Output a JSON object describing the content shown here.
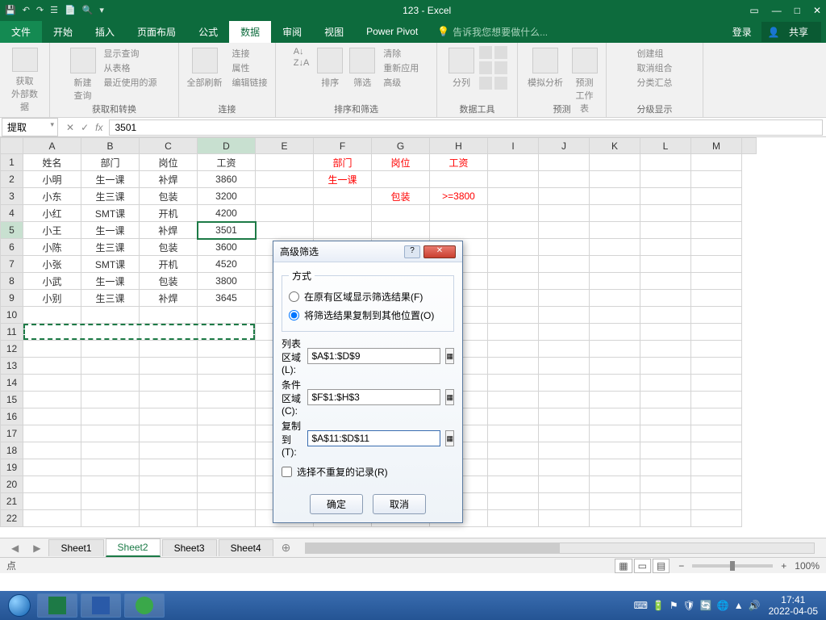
{
  "titlebar": {
    "title": "123 - Excel"
  },
  "menu": {
    "file": "文件",
    "tabs": [
      "开始",
      "插入",
      "页面布局",
      "公式",
      "数据",
      "审阅",
      "视图",
      "Power Pivot"
    ],
    "active": "数据",
    "tellme": "告诉我您想要做什么...",
    "login": "登录",
    "share": "共享"
  },
  "ribbon": {
    "g1": {
      "btn": "获取\n外部数据",
      "label": ""
    },
    "g2": {
      "btn": "新建\n查询",
      "i1": "显示查询",
      "i2": "从表格",
      "i3": "最近使用的源",
      "label": "获取和转换"
    },
    "g3": {
      "btn": "全部刷新",
      "i1": "连接",
      "i2": "属性",
      "i3": "编辑链接",
      "label": "连接"
    },
    "g4": {
      "b1": "A↓",
      "b2": "Z↓A",
      "b3": "排序",
      "b4": "筛选",
      "i1": "清除",
      "i2": "重新应用",
      "i3": "高级",
      "label": "排序和筛选"
    },
    "g5": {
      "btn": "分列",
      "label": "数据工具"
    },
    "g6": {
      "b1": "模拟分析",
      "b2": "预测\n工作表",
      "label": "预测"
    },
    "g7": {
      "i1": "创建组",
      "i2": "取消组合",
      "i3": "分类汇总",
      "label": "分级显示"
    }
  },
  "namebox": {
    "ref": "提取",
    "fx": "fx",
    "formula": "3501"
  },
  "cols": [
    "",
    "A",
    "B",
    "C",
    "D",
    "E",
    "F",
    "G",
    "H",
    "I",
    "J",
    "K",
    "L",
    "M"
  ],
  "rows": [
    {
      "r": "1",
      "c": [
        "姓名",
        "部门",
        "岗位",
        "工资",
        "",
        "部门",
        "岗位",
        "工资",
        "",
        "",
        "",
        "",
        ""
      ]
    },
    {
      "r": "2",
      "c": [
        "小明",
        "生一课",
        "补焊",
        "3860",
        "",
        "生一课",
        "",
        "",
        "",
        "",
        "",
        "",
        ""
      ]
    },
    {
      "r": "3",
      "c": [
        "小东",
        "生三课",
        "包装",
        "3200",
        "",
        "",
        "包装",
        ">=3800",
        "",
        "",
        "",
        "",
        ""
      ]
    },
    {
      "r": "4",
      "c": [
        "小红",
        "SMT课",
        "开机",
        "4200",
        "",
        "",
        "",
        "",
        "",
        "",
        "",
        "",
        ""
      ]
    },
    {
      "r": "5",
      "c": [
        "小王",
        "生一课",
        "补焊",
        "3501",
        "",
        "",
        "",
        "",
        "",
        "",
        "",
        "",
        ""
      ]
    },
    {
      "r": "6",
      "c": [
        "小陈",
        "生三课",
        "包装",
        "3600",
        "",
        "",
        "",
        "",
        "",
        "",
        "",
        "",
        ""
      ]
    },
    {
      "r": "7",
      "c": [
        "小张",
        "SMT课",
        "开机",
        "4520",
        "",
        "",
        "",
        "",
        "",
        "",
        "",
        "",
        ""
      ]
    },
    {
      "r": "8",
      "c": [
        "小武",
        "生一课",
        "包装",
        "3800",
        "",
        "",
        "",
        "",
        "",
        "",
        "",
        "",
        ""
      ]
    },
    {
      "r": "9",
      "c": [
        "小别",
        "生三课",
        "补焊",
        "3645",
        "",
        "",
        "",
        "",
        "",
        "",
        "",
        "",
        ""
      ]
    }
  ],
  "criteria_red": {
    "F1": "部门",
    "G1": "岗位",
    "H1": "工资",
    "F2": "生一课",
    "G3": "包装",
    "H3": ">=3800"
  },
  "dialog": {
    "title": "高级筛选",
    "mode_label": "方式",
    "radio1": "在原有区域显示筛选结果(F)",
    "radio2": "将筛选结果复制到其他位置(O)",
    "list_label": "列表区域(L):",
    "list_val": "$A$1:$D$9",
    "crit_label": "条件区域(C):",
    "crit_val": "$F$1:$H$3",
    "copy_label": "复制到(T):",
    "copy_val": "$A$11:$D$11",
    "unique": "选择不重复的记录(R)",
    "ok": "确定",
    "cancel": "取消"
  },
  "sheets": {
    "tabs": [
      "Sheet1",
      "Sheet2",
      "Sheet3",
      "Sheet4"
    ],
    "active": "Sheet2"
  },
  "status": {
    "mode": "点",
    "zoom": "100%"
  },
  "taskbar": {
    "time": "17:41",
    "date": "2022-04-05"
  }
}
